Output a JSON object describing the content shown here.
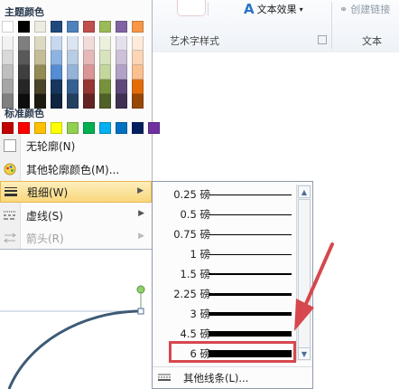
{
  "ribbon": {
    "text_effect_label": "文本效果",
    "create_link_label": "创建链接",
    "group_art_text": "艺术字样式",
    "group_text": "文本"
  },
  "colors": {
    "theme_title": "主题颜色",
    "standard_title": "标准颜色",
    "theme_columns": [
      [
        "#ffffff",
        "#f2f2f2",
        "#d9d9d9",
        "#bfbfbf",
        "#a6a6a6",
        "#808080"
      ],
      [
        "#000000",
        "#7f7f7f",
        "#595959",
        "#3f3f3f",
        "#262626",
        "#0d0d0d"
      ],
      [
        "#eeece1",
        "#ddd9c3",
        "#c4bd97",
        "#948a54",
        "#4a452a",
        "#1d1b10"
      ],
      [
        "#1f497d",
        "#c6d9f0",
        "#8db3e2",
        "#548dd4",
        "#17365d",
        "#0f243e"
      ],
      [
        "#4f81bd",
        "#dbe5f1",
        "#b8cce4",
        "#95b3d7",
        "#366092",
        "#244061"
      ],
      [
        "#c0504d",
        "#f2dcdb",
        "#e5b9b7",
        "#d99694",
        "#953734",
        "#632423"
      ],
      [
        "#9bbb59",
        "#ebf1dd",
        "#d7e3bc",
        "#c3d69b",
        "#76923c",
        "#4f6128"
      ],
      [
        "#8064a2",
        "#e5e0ec",
        "#ccc1d9",
        "#b2a2c7",
        "#5f497a",
        "#3f3151"
      ],
      [
        "#f79646",
        "#fdeada",
        "#fbd5b5",
        "#fac08f",
        "#e36c09",
        "#974806"
      ]
    ],
    "standard": [
      "#c00000",
      "#ff0000",
      "#ffc000",
      "#ffff00",
      "#92d050",
      "#00b050",
      "#00b0f0",
      "#0070c0",
      "#002060",
      "#7030a0"
    ]
  },
  "menu": {
    "no_outline": "无轮廓(N)",
    "more_colors": "其他轮廓颜色(M)...",
    "weight": "粗细(W)",
    "dash": "虚线(S)",
    "arrows": "箭头(R)"
  },
  "weights": [
    {
      "label": "0.25 磅",
      "pt": 0.25
    },
    {
      "label": "0.5 磅",
      "pt": 0.5
    },
    {
      "label": "0.75 磅",
      "pt": 0.75
    },
    {
      "label": "1 磅",
      "pt": 1
    },
    {
      "label": "1.5 磅",
      "pt": 1.5
    },
    {
      "label": "2.25 磅",
      "pt": 2.25
    },
    {
      "label": "3 磅",
      "pt": 3
    },
    {
      "label": "4.5 磅",
      "pt": 4.5
    },
    {
      "label": "6 磅",
      "pt": 6
    }
  ],
  "more_lines": "其他线条(L)...",
  "accent_color": "#d6474e",
  "shape_color": "#3e5a75"
}
